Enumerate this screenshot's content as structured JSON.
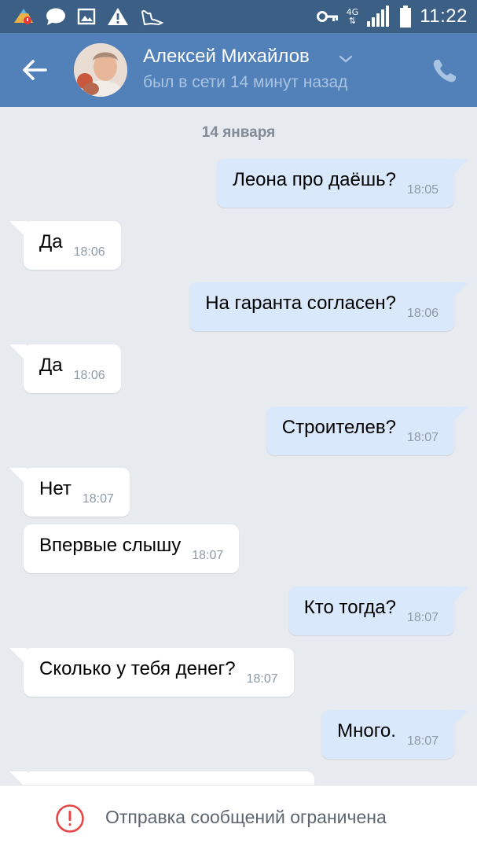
{
  "status_bar": {
    "time": "11:22",
    "network": "4G",
    "icons": [
      "cleaner-app-icon",
      "chat-icon",
      "image-icon",
      "warning-icon",
      "notification-icon",
      "key-icon",
      "signal-icon",
      "battery-icon"
    ]
  },
  "header": {
    "contact_name": "Алексей Михайлов",
    "last_seen": "был в сети 14 минут назад"
  },
  "chat": {
    "date_separator": "14 января",
    "messages": [
      {
        "direction": "out",
        "text": "Леона про даёшь?",
        "time": "18:05"
      },
      {
        "direction": "in",
        "text": "Да",
        "time": "18:06"
      },
      {
        "direction": "out",
        "text": "На гаранта согласен?",
        "time": "18:06"
      },
      {
        "direction": "in",
        "text": "Да",
        "time": "18:06"
      },
      {
        "direction": "out",
        "text": "Строителев?",
        "time": "18:07"
      },
      {
        "direction": "in",
        "text": "Нет",
        "time": "18:07"
      },
      {
        "direction": "in",
        "text": "Впервые слышу",
        "time": "18:07"
      },
      {
        "direction": "out",
        "text": "Кто тогда?",
        "time": "18:07"
      },
      {
        "direction": "in",
        "text": "Сколько у тебя денег?",
        "time": "18:07"
      },
      {
        "direction": "out",
        "text": "Много.",
        "time": "18:07"
      }
    ]
  },
  "bottom": {
    "restriction_text": "Отправка сообщений ограничена"
  },
  "colors": {
    "header": "#5181b8",
    "status_bar": "#3c5f86",
    "background": "#e7ebf0",
    "outgoing_bubble": "#d9e8fa",
    "incoming_bubble": "#ffffff",
    "alert": "#e64646"
  }
}
